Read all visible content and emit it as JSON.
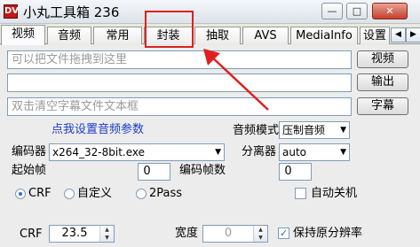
{
  "window": {
    "app_icon": "dv-app-icon",
    "title": "小丸工具箱 236",
    "minimize": "—",
    "maximize": "□",
    "close": "✕"
  },
  "tabs": [
    "视频",
    "音频",
    "常用",
    "封装",
    "抽取",
    "AVS",
    "MediaInfo",
    "设置"
  ],
  "active_tab": "视频",
  "tab_scroll": {
    "left": "◀",
    "right": "▶"
  },
  "inputs": {
    "video_placeholder": "可以把文件拖拽到这里",
    "output_value": "",
    "subtitle_placeholder": "双击清空字幕文件文本框"
  },
  "buttons": {
    "video": "视频",
    "output": "输出",
    "subtitle": "字幕"
  },
  "audio": {
    "settings_link": "点我设置音频参数",
    "mode_label": "音频模式",
    "mode_value": "压制音频"
  },
  "encoder": {
    "label": "编码器",
    "value": "x264_32-8bit.exe",
    "splitter_label": "分离器",
    "splitter_value": "auto"
  },
  "frames": {
    "start_label": "起始帧",
    "start_value": "0",
    "count_label": "编码帧数",
    "count_value": "0"
  },
  "rate_mode": {
    "options": [
      "CRF",
      "自定义",
      "2Pass"
    ],
    "selected": "CRF",
    "shutdown_label": "自动关机"
  },
  "crf": {
    "label": "CRF",
    "value": "23.5",
    "width_label": "宽度",
    "width_value": "0",
    "keep_res_label": "保持原分辨率",
    "keep_res_checked": true
  },
  "colors": {
    "highlight": "#e02020",
    "link": "#1c3cc8",
    "radio_dot": "#2a6ad8"
  }
}
